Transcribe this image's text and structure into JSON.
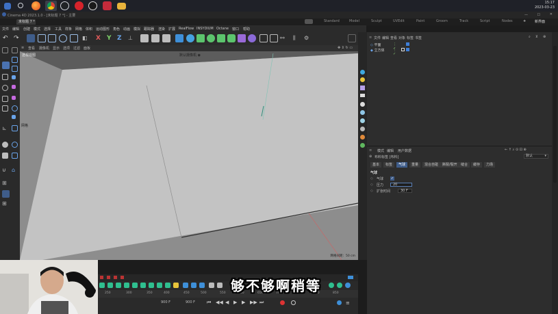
{
  "taskbar": {
    "clock_time": "15:17",
    "clock_date": "2023-03-23",
    "apps": [
      "windows-start",
      "search",
      "firefox",
      "chrome",
      "obs",
      "netease-music",
      "cinema4d-app",
      "recorder",
      "folder"
    ]
  },
  "window": {
    "title": "Cinema 4D 2023.1.0 - [未标题 7 *] - 主要"
  },
  "doc_tab": "未标题 7 *",
  "layout_tabs": [
    "Standard",
    "Model",
    "Sculpt",
    "UVEdit",
    "Paint",
    "Groom",
    "Track",
    "Script",
    "Nodes"
  ],
  "layout_button": "新界面",
  "menu": [
    "文件",
    "编辑",
    "创建",
    "模式",
    "选择",
    "工具",
    "样条",
    "网格",
    "体积",
    "运动图形",
    "角色",
    "动画",
    "模拟",
    "跟踪器",
    "渲染",
    "扩展",
    "RealFlow",
    "INSYDIUM",
    "Octane",
    "窗口",
    "帮助"
  ],
  "viewport": {
    "menu": [
      "查看",
      "摄像机",
      "显示",
      "选项",
      "过滤",
      "面板"
    ],
    "label": "透视视图",
    "camera_label": "默认摄像机 ◉",
    "axis_label": "网格",
    "grid_spacing": "网格间距：50 cm"
  },
  "object_manager": {
    "tabs": [
      "文件",
      "编辑",
      "查看",
      "对象",
      "标签",
      "书签"
    ],
    "objects": [
      {
        "name": "平面"
      },
      {
        "name": "立方体"
      }
    ]
  },
  "attribute_manager": {
    "tabs_top": [
      "模式",
      "编辑",
      "用户数据"
    ],
    "object_title": "布料标签 [布料]",
    "mode_select": "默认",
    "tabs": [
      "基本",
      "标签",
      "气球",
      "重量",
      "混合自碰",
      "撕裂/裂开",
      "缝合",
      "缓存",
      "力场"
    ],
    "active_tab": "气球",
    "section": "气球",
    "fields": [
      {
        "label": "气球",
        "value": "✓"
      },
      {
        "label": "压力",
        "value": "20"
      },
      {
        "label": "扩张时间",
        "value": "30 F"
      }
    ]
  },
  "timeline": {
    "ruler": [
      "250",
      "300",
      "350",
      "400",
      "450",
      "500",
      "550",
      "600",
      "650",
      "700",
      "750",
      "800",
      "850"
    ],
    "current_frame": "0 F",
    "start_frame": "900 F",
    "end_frame": "900 F"
  },
  "subtitle": "够不够啊稍等"
}
